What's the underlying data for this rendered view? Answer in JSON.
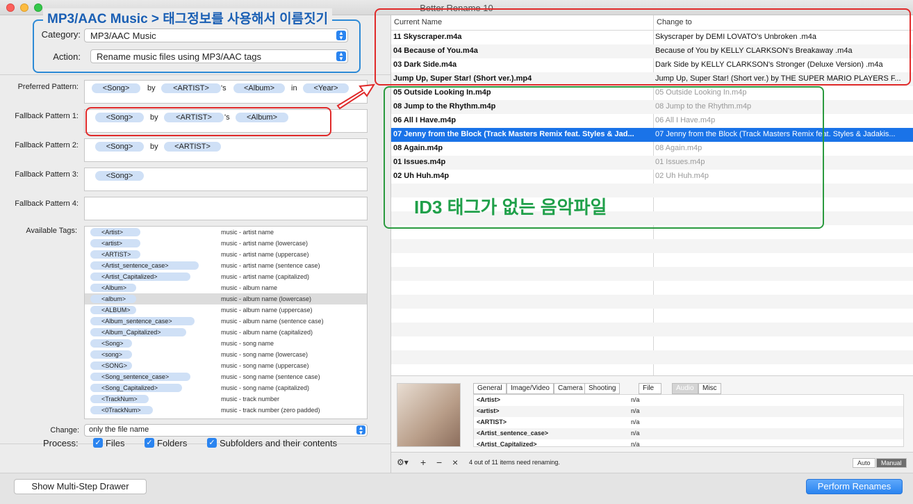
{
  "window": {
    "title": "Better Rename 10"
  },
  "annotations": {
    "top_title": "MP3/AAC Music > 태그정보를 사용해서 이름짓기",
    "green_label": "ID3 태그가 없는 음악파일"
  },
  "form": {
    "category_label": "Category:",
    "category_value": "MP3/AAC Music",
    "action_label": "Action:",
    "action_value": "Rename music files using MP3/AAC tags",
    "preferred_label": "Preferred Pattern:",
    "fallback1_label": "Fallback Pattern 1:",
    "fallback2_label": "Fallback Pattern 2:",
    "fallback3_label": "Fallback Pattern 3:",
    "fallback4_label": "Fallback Pattern 4:",
    "available_tags_label": "Available Tags:",
    "change_label": "Change:",
    "change_value": "only the file name",
    "process_label": "Process:",
    "files_label": "Files",
    "folders_label": "Folders",
    "subfolders_label": "Subfolders and their contents",
    "check_mark": "✓"
  },
  "patterns": {
    "preferred": {
      "song": "<Song>",
      "by": "by",
      "artist": "<ARTIST>",
      "apos": "'s",
      "album": "<Album>",
      "in": "in",
      "year": "<Year>"
    },
    "fallback1": {
      "song": "<Song>",
      "by": "by",
      "artist": "<ARTIST>",
      "apos": "'s",
      "album": "<Album>"
    },
    "fallback2": {
      "song": "<Song>",
      "by": "by",
      "artist": "<ARTIST>"
    },
    "fallback3": {
      "song": "<Song>"
    }
  },
  "tags": [
    {
      "tag": "<Artist>",
      "desc": "music - artist name"
    },
    {
      "tag": "<artist>",
      "desc": "music - artist name (lowercase)"
    },
    {
      "tag": "<ARTIST>",
      "desc": "music - artist name (uppercase)"
    },
    {
      "tag": "<Artist_sentence_case>",
      "desc": "music - artist name (sentence case)"
    },
    {
      "tag": "<Artist_Capitalized>",
      "desc": "music - artist name (capitalized)"
    },
    {
      "tag": "<Album>",
      "desc": "music - album name"
    },
    {
      "tag": "<album>",
      "desc": "music - album name (lowercase)"
    },
    {
      "tag": "<ALBUM>",
      "desc": "music - album name (uppercase)"
    },
    {
      "tag": "<Album_sentence_case>",
      "desc": "music - album name (sentence case)"
    },
    {
      "tag": "<Album_Capitalized>",
      "desc": "music - album name (capitalized)"
    },
    {
      "tag": "<Song>",
      "desc": "music - song name"
    },
    {
      "tag": "<song>",
      "desc": "music - song name (lowercase)"
    },
    {
      "tag": "<SONG>",
      "desc": "music - song name (uppercase)"
    },
    {
      "tag": "<Song_sentence_case>",
      "desc": "music - song name (sentence case)"
    },
    {
      "tag": "<Song_Capitalized>",
      "desc": "music - song name (capitalized)"
    },
    {
      "tag": "<TrackNum>",
      "desc": "music - track number"
    },
    {
      "tag": "<0TrackNum>",
      "desc": "music - track number (zero padded)"
    }
  ],
  "table": {
    "col_current": "Current Name",
    "col_change": "Change to",
    "rows": [
      {
        "current": "11 Skyscraper.m4a",
        "change": "Skyscraper by DEMI LOVATO's Unbroken .m4a",
        "dim": false
      },
      {
        "current": "04 Because of You.m4a",
        "change": "Because of You by KELLY CLARKSON's Breakaway .m4a",
        "dim": false
      },
      {
        "current": "03 Dark Side.m4a",
        "change": "Dark Side by KELLY CLARKSON's Stronger (Deluxe Version) .m4a",
        "dim": false
      },
      {
        "current": "Jump Up, Super Star! (Short ver.).mp4",
        "change": "Jump Up, Super Star! (Short ver.) by THE SUPER MARIO PLAYERS F...",
        "dim": false
      },
      {
        "current": "05 Outside Looking In.m4p",
        "change": "05 Outside Looking In.m4p",
        "dim": true
      },
      {
        "current": "08 Jump to the Rhythm.m4p",
        "change": "08 Jump to the Rhythm.m4p",
        "dim": true
      },
      {
        "current": "06 All I Have.m4p",
        "change": "06 All I Have.m4p",
        "dim": true
      },
      {
        "current": "07 Jenny from the Block (Track Masters Remix feat. Styles & Jad...",
        "change": "07 Jenny from the Block (Track Masters Remix feat. Styles & Jadakis...",
        "dim": false,
        "selected": true
      },
      {
        "current": "08 Again.m4p",
        "change": "08 Again.m4p",
        "dim": true
      },
      {
        "current": "01 Issues.m4p",
        "change": "01 Issues.m4p",
        "dim": true
      },
      {
        "current": "02 Uh Huh.m4p",
        "change": "02 Uh Huh.m4p",
        "dim": true
      }
    ]
  },
  "info": {
    "tabs": [
      "General",
      "Image/Video",
      "Camera",
      "Shooting Date",
      "File Date",
      "Audio",
      "Misc"
    ],
    "active_tab": "Audio",
    "meta": [
      {
        "k": "<Artist>",
        "v": "n/a"
      },
      {
        "k": "<artist>",
        "v": "n/a"
      },
      {
        "k": "<ARTIST>",
        "v": "n/a"
      },
      {
        "k": "<Artist_sentence_case>",
        "v": "n/a"
      },
      {
        "k": "<Artist_Capitalized>",
        "v": "n/a"
      }
    ]
  },
  "status": {
    "gear": "⚙▾",
    "plus": "+",
    "minus": "−",
    "close": "×",
    "text": "4 out of 11 items need renaming.",
    "auto": "Auto",
    "manual": "Manual"
  },
  "footer": {
    "drawer_button": "Show Multi-Step Drawer",
    "perform_button": "Perform Renames"
  }
}
